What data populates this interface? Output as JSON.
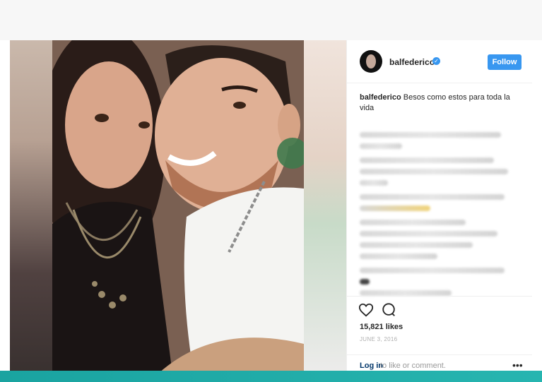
{
  "post": {
    "username": "balfederico",
    "verified_icon": "verified-badge-icon",
    "follow_label": "Follow",
    "caption_user": "balfederico",
    "caption_text": "Besos como estos para toda la vida",
    "likes": "15,821 likes",
    "date": "JUNE 3, 2016",
    "login_link": "Log in",
    "login_rest": "to like or comment.",
    "more_label": "•••"
  },
  "icons": {
    "like": "heart-icon",
    "comment": "comment-icon"
  },
  "colors": {
    "accent": "#3897f0",
    "link": "#003569",
    "bottom_strip": "#1aa3a0"
  }
}
